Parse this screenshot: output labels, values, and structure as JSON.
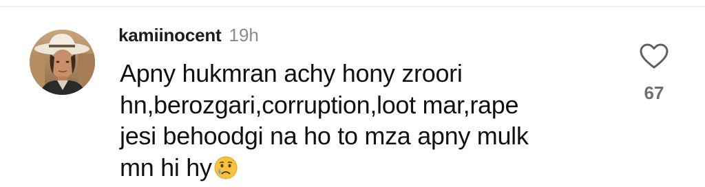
{
  "comment": {
    "username": "kamiinocent",
    "timestamp": "19h",
    "text_lines": [
      "Apny hukmran achy hony zroori",
      "hn,berozgari,corruption,loot mar,rape",
      "jesi behoodgi na ho to mza apny mulk",
      "mn hi hy"
    ],
    "emoji": "crying-face-emoji",
    "like_icon": "heart-outline-icon",
    "like_count": "67"
  },
  "colors": {
    "username": "#1c1c1c",
    "timestamp": "#8a8a8a",
    "text": "#111111",
    "like_count": "#6f6f6f",
    "icon": "#5f5f5f"
  }
}
